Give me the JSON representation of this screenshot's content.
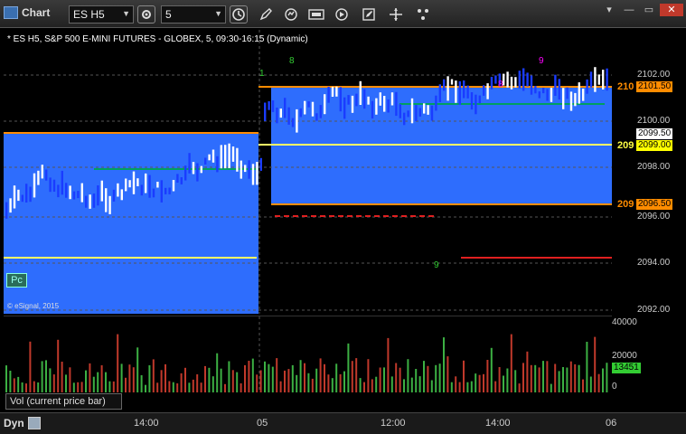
{
  "window": {
    "title": "Chart"
  },
  "toolbar": {
    "symbol": "ES H5",
    "interval": "5",
    "buttons": [
      "clock-icon",
      "pencil-icon",
      "refresh-icon",
      "cursor-icon",
      "play-icon",
      "edit-icon",
      "move-icon",
      "dots-icon"
    ]
  },
  "chart": {
    "title": "* ES H5, S&P 500 E-MINI FUTURES - GLOBEX, 5, 09:30-16:15 (Dynamic)",
    "copyright": "© eSignal, 2015",
    "pc_label": "Pc",
    "colors": {
      "range_box": "#2e6dfd",
      "orange_line": "#ff8c00",
      "yellow_line": "#ffff66",
      "green_line": "#00a060",
      "red_line": "#e02020"
    },
    "y_ticks": [
      "2102.00",
      "2100.00",
      "2098.00",
      "2096.00",
      "2094.00",
      "2092.00"
    ],
    "price_tags": [
      {
        "text": "2101.50",
        "bg": "#ff8c00",
        "fg": "#000"
      },
      {
        "text": "2099.50",
        "bg": "#ffffff",
        "fg": "#000"
      },
      {
        "text": "2099.00",
        "bg": "#ffff00",
        "fg": "#000"
      },
      {
        "text": "2096.50",
        "bg": "#ff8c00",
        "fg": "#000"
      }
    ],
    "edge_labels": [
      "210",
      "209",
      "209"
    ],
    "x_labels": [
      "14:00",
      "05",
      "12:00",
      "14:00",
      "06"
    ],
    "seq_counts": [
      {
        "text": "1",
        "color": "#3c3"
      },
      {
        "text": "8",
        "color": "#3c3"
      },
      {
        "text": "9",
        "color": "#3c3"
      },
      {
        "text": "9",
        "color": "#f0f"
      },
      {
        "text": "8",
        "color": "#f0f"
      },
      {
        "text": "9",
        "color": "#3c3"
      }
    ]
  },
  "volume": {
    "tab_label": "Vol (current price bar)",
    "y_ticks": [
      "40000",
      "20000",
      "0"
    ],
    "current": "13451"
  },
  "footer": {
    "dyn_label": "Dyn"
  }
}
